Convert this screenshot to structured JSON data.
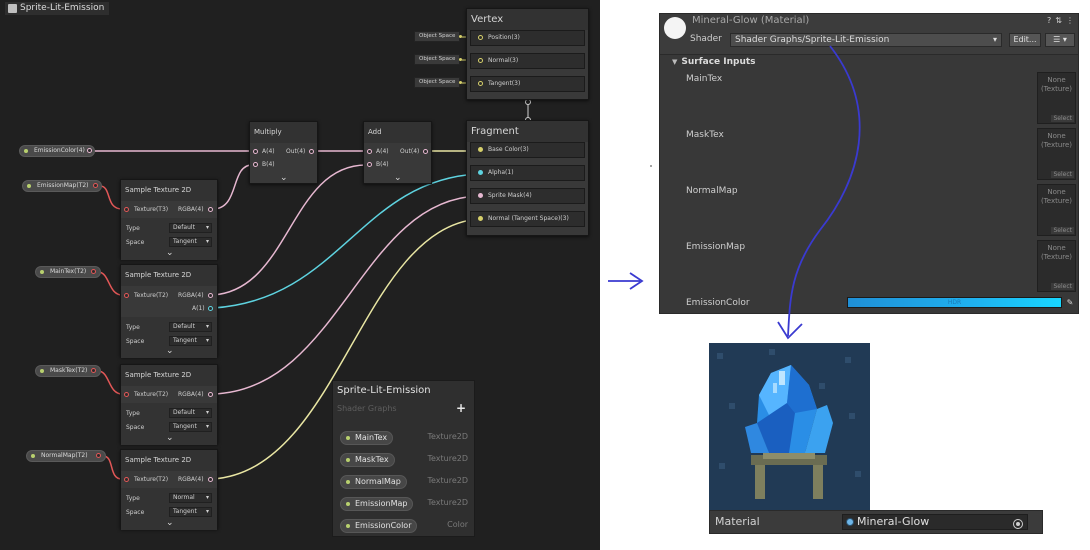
{
  "graph": {
    "title": "Sprite-Lit-Emission",
    "colors": {
      "background": "#202020",
      "wire_pink": "#e7b8d1",
      "wire_cyan": "#5ed3e0",
      "wire_yellow": "#e9e6a3",
      "wire_red": "#e25757",
      "port_yellow": "#d6d06b"
    },
    "vertex": {
      "title": "Vertex",
      "ports": [
        "Position(3)",
        "Normal(3)",
        "Tangent(3)"
      ],
      "tags": [
        "Object Space",
        "Object Space",
        "Object Space"
      ]
    },
    "fragment": {
      "title": "Fragment",
      "ports": [
        "Base Color(3)",
        "Alpha(1)",
        "Sprite Mask(4)",
        "Normal (Tangent Space)(3)"
      ]
    },
    "multiply": {
      "title": "Multiply",
      "in_a": "A(4)",
      "in_b": "B(4)",
      "out": "Out(4)"
    },
    "add": {
      "title": "Add",
      "in_a": "A(4)",
      "in_b": "B(4)",
      "out": "Out(4)"
    },
    "emission_color_prop": "EmissionColor(4)",
    "properties": [
      "EmissionMap(T2)",
      "MainTex(T2)",
      "MaskTex(T2)",
      "NormalMap(T2)"
    ],
    "samplers": [
      {
        "title": "Sample Texture 2D",
        "texture_in": "Texture(T3)",
        "rgba": "RGBA(4)",
        "type_label": "Type",
        "type_value": "Default",
        "space_label": "Space",
        "space_value": "Tangent"
      },
      {
        "title": "Sample Texture 2D",
        "texture_in": "Texture(T2)",
        "rgba": "RGBA(4)",
        "alpha": "A(1)",
        "type_label": "Type",
        "type_value": "Default",
        "space_label": "Space",
        "space_value": "Tangent"
      },
      {
        "title": "Sample Texture 2D",
        "texture_in": "Texture(T2)",
        "rgba": "RGBA(4)",
        "type_label": "Type",
        "type_value": "Default",
        "space_label": "Space",
        "space_value": "Tangent"
      },
      {
        "title": "Sample Texture 2D",
        "texture_in": "Texture(T2)",
        "rgba": "RGBA(4)",
        "type_label": "Type",
        "type_value": "Normal",
        "space_label": "Space",
        "space_value": "Tangent"
      }
    ],
    "blackboard": {
      "title": "Sprite-Lit-Emission",
      "subtitle": "Shader Graphs",
      "add": "+",
      "rows": [
        {
          "name": "MainTex",
          "type": "Texture2D"
        },
        {
          "name": "MaskTex",
          "type": "Texture2D"
        },
        {
          "name": "NormalMap",
          "type": "Texture2D"
        },
        {
          "name": "EmissionMap",
          "type": "Texture2D"
        },
        {
          "name": "EmissionColor",
          "type": "Color"
        }
      ]
    }
  },
  "inspector": {
    "material_name": "Mineral-Glow (Material)",
    "icons": [
      "?",
      "⇅",
      "⋮"
    ],
    "shader_label": "Shader",
    "shader_value": "Shader Graphs/Sprite-Lit-Emission",
    "edit_label": "Edit...",
    "menu_label": "☰ ▾",
    "section_title": "Surface Inputs",
    "section_toggle": "▼",
    "textures": [
      {
        "label": "MainTex",
        "slot_text": "None\n(Texture)",
        "select": "Select"
      },
      {
        "label": "MaskTex",
        "slot_text": "None\n(Texture)",
        "select": "Select"
      },
      {
        "label": "NormalMap",
        "slot_text": "None\n(Texture)",
        "select": "Select"
      },
      {
        "label": "EmissionMap",
        "slot_text": "None\n(Texture)",
        "select": "Select"
      }
    ],
    "emission_color_label": "EmissionColor",
    "hdr_label": "HDR",
    "eyedropper_icon": "eyedropper-icon"
  },
  "material_field": {
    "label": "Material",
    "value": "Mineral-Glow"
  },
  "annotation": {
    "arrow": "→",
    "color": "#3a3ad0"
  }
}
